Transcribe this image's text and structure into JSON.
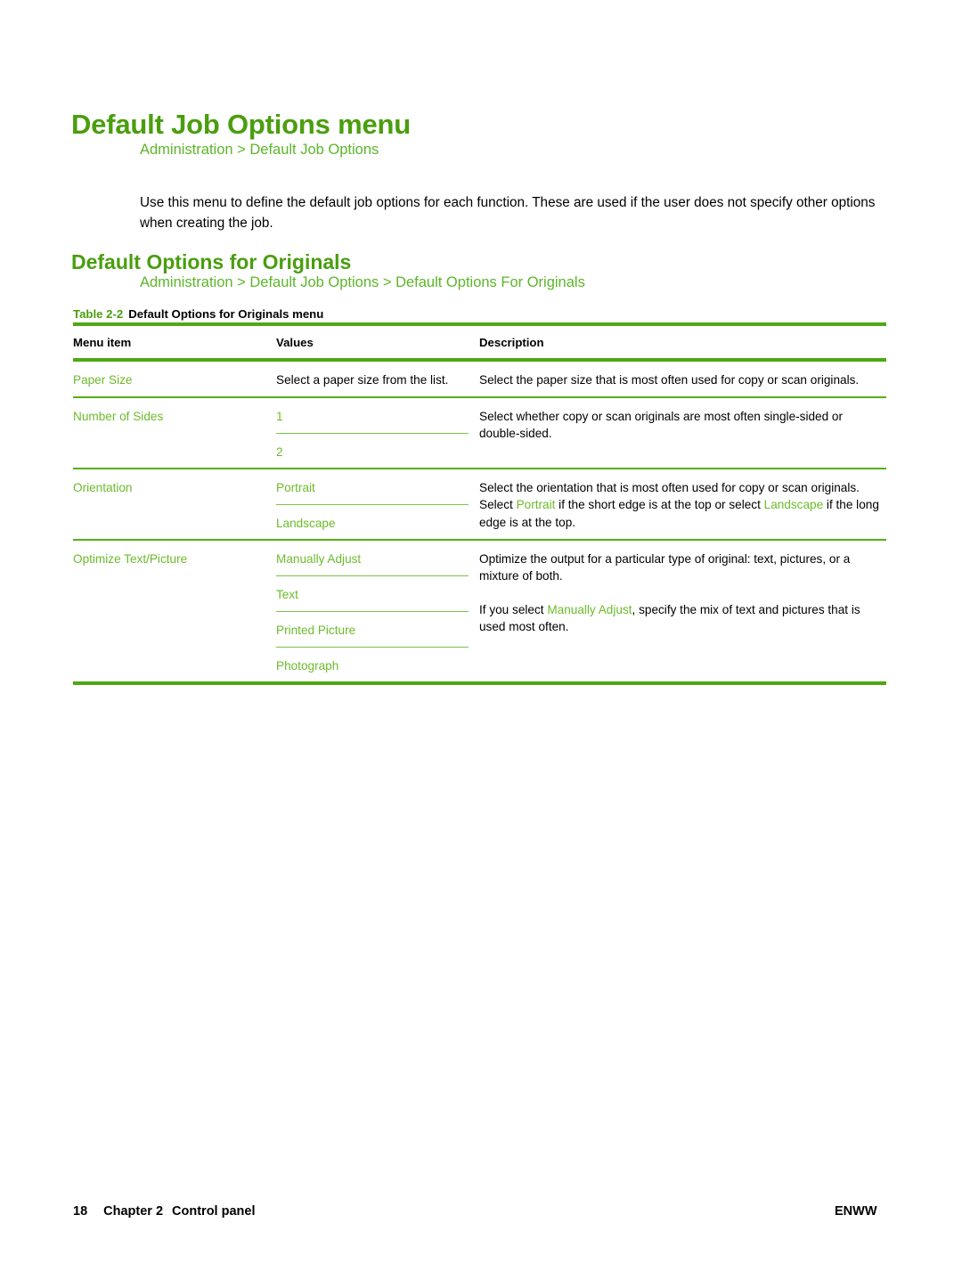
{
  "page": {
    "title": "Default Job Options menu",
    "breadcrumb_top": "Administration > Default Job Options",
    "intro": "Use this menu to define the default job options for each function. These are used if the user does not specify other options when creating the job.",
    "section_heading": "Default Options for Originals",
    "breadcrumb_section": "Administration > Default Job Options > Default Options For Originals"
  },
  "table": {
    "caption_number": "Table 2-2",
    "caption_title": "Default Options for Originals menu",
    "headers": {
      "menu_item": "Menu item",
      "values": "Values",
      "description": "Description"
    },
    "rows": [
      {
        "menu_item": "Paper Size",
        "values_plain": "Select a paper size from the list.",
        "values": [],
        "description_parts": [
          [
            {
              "text": "Select the paper size that is most often used for copy or scan originals.",
              "green": false
            }
          ]
        ]
      },
      {
        "menu_item": "Number of Sides",
        "values_plain": "",
        "values": [
          "1",
          "2"
        ],
        "description_parts": [
          [
            {
              "text": "Select whether copy or scan originals are most often single-sided or double-sided.",
              "green": false
            }
          ]
        ]
      },
      {
        "menu_item": "Orientation",
        "values_plain": "",
        "values": [
          "Portrait",
          "Landscape"
        ],
        "description_parts": [
          [
            {
              "text": "Select the orientation that is most often used for copy or scan originals. Select ",
              "green": false
            },
            {
              "text": "Portrait",
              "green": true
            },
            {
              "text": " if the short edge is at the top or select ",
              "green": false
            },
            {
              "text": "Landscape",
              "green": true
            },
            {
              "text": " if the long edge is at the top.",
              "green": false
            }
          ]
        ]
      },
      {
        "menu_item": "Optimize Text/Picture",
        "values_plain": "",
        "values": [
          "Manually Adjust",
          "Text",
          "Printed Picture",
          "Photograph"
        ],
        "description_parts": [
          [
            {
              "text": "Optimize the output for a particular type of original: text, pictures, or a mixture of both.",
              "green": false
            }
          ],
          [
            {
              "text": "If you select ",
              "green": false
            },
            {
              "text": "Manually Adjust",
              "green": true
            },
            {
              "text": ", specify the mix of text and pictures that is used most often.",
              "green": false
            }
          ]
        ]
      }
    ]
  },
  "footer": {
    "page_number": "18",
    "chapter": "Chapter 2",
    "chapter_title": "Control panel",
    "locale": "ENWW"
  },
  "colors": {
    "heading_green": "#4a9e0e",
    "link_green": "#5cb62a",
    "value_green": "#6cbb2b",
    "rule_green": "#4fa812",
    "body_black": "#000000"
  }
}
